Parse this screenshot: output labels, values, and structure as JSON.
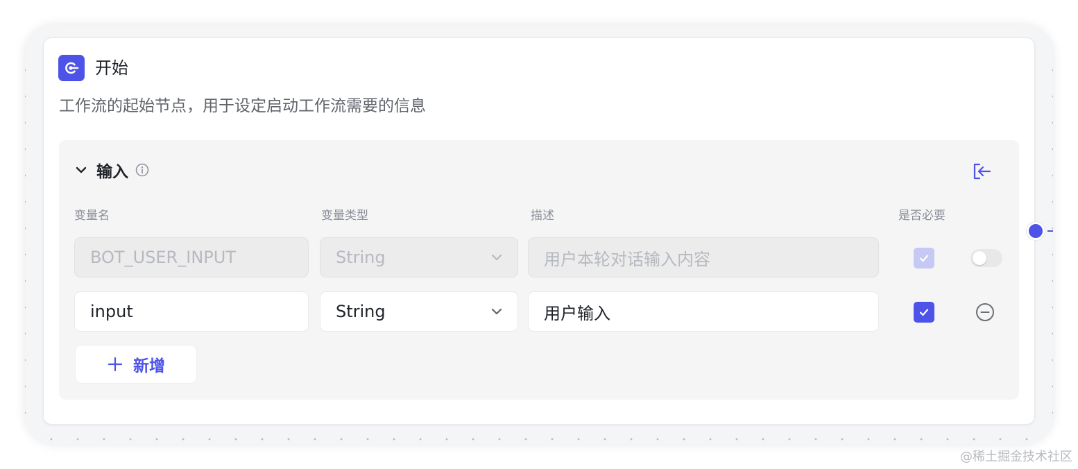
{
  "node": {
    "title": "开始",
    "description": "工作流的起始节点，用于设定启动工作流需要的信息",
    "icon": "start-node-icon"
  },
  "input_section": {
    "title": "输入",
    "expanded": true,
    "columns": {
      "name": "变量名",
      "type": "变量类型",
      "description": "描述",
      "required": "是否必要"
    },
    "rows": [
      {
        "name": "BOT_USER_INPUT",
        "type": "String",
        "description": "用户本轮对话输入内容",
        "required": true,
        "disabled": true
      },
      {
        "name": "input",
        "type": "String",
        "description": "用户输入",
        "required": true,
        "disabled": false
      }
    ],
    "add_label": "新增"
  },
  "watermark": "@稀土掘金技术社区",
  "colors": {
    "accent": "#4d53e8",
    "section_bg": "#f5f5f6",
    "canvas_bg": "#f4f5f6"
  }
}
